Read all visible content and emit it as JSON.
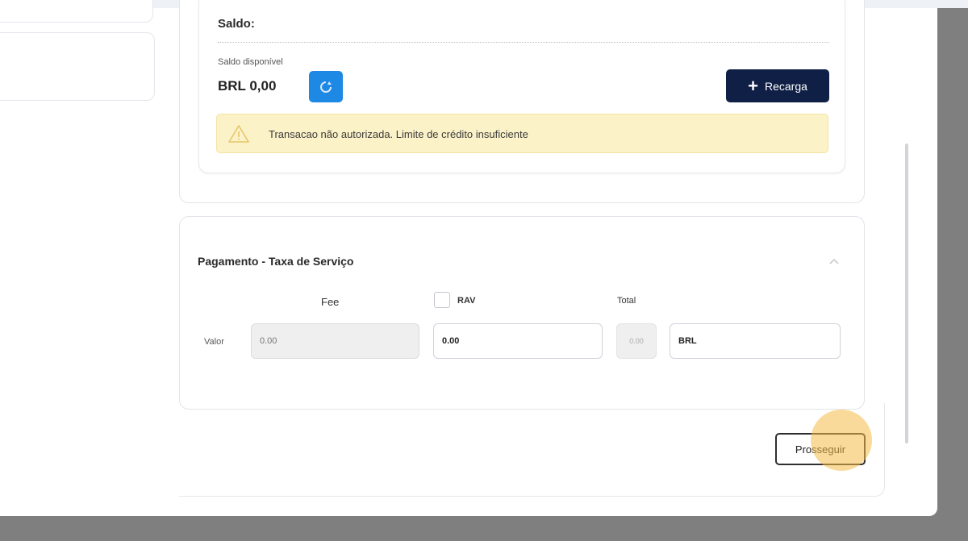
{
  "saldo": {
    "title": "Saldo:",
    "available_label": "Saldo disponível",
    "value": "BRL 0,00",
    "refresh_icon": "refresh-icon",
    "recarga_label": "Recarga"
  },
  "alert": {
    "icon": "warning-icon",
    "message": "Transacao não autorizada. Limite de crédito insuficiente"
  },
  "payment": {
    "title": "Pagamento - Taxa de Serviço",
    "fee_header": "Fee",
    "rav_header": "RAV",
    "rav_checked": false,
    "total_header": "Total",
    "valor_label": "Valor",
    "fee_value": "0.00",
    "rav_value": "0.00",
    "total_value": "0.00",
    "currency_value": "BRL"
  },
  "actions": {
    "prosseguir_label": "Prosseguir"
  },
  "colors": {
    "accent_blue": "#1e88e5",
    "navy": "#0f1f45",
    "alert_bg": "#fcf2c8",
    "click_highlight": "#f5bc48"
  }
}
